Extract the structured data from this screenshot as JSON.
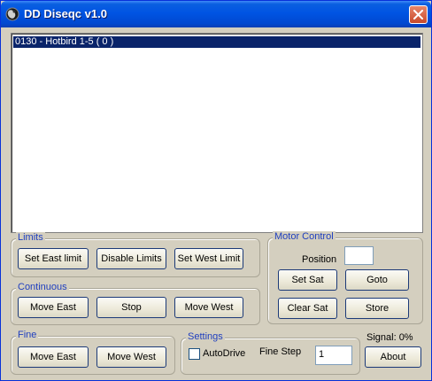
{
  "window": {
    "title": "DD Diseqc v1.0",
    "icons": {
      "app": "satellite-dish-icon",
      "close": "close-icon"
    },
    "colors": {
      "titlebar": "#0054e3",
      "face": "#d4cfbf",
      "selection": "#0a246a",
      "group_title": "#1f3fbf"
    }
  },
  "channel_list": {
    "items": [
      {
        "label": "0130 - Hotbird 1-5 ( 0 )",
        "selected": true
      }
    ]
  },
  "limits": {
    "title": "Limits",
    "set_east_label": "Set East limit",
    "disable_label": "Disable Limits",
    "set_west_label": "Set West Limit"
  },
  "continuous": {
    "title": "Continuous",
    "move_east_label": "Move East",
    "stop_label": "Stop",
    "move_west_label": "Move West"
  },
  "fine": {
    "title": "Fine",
    "move_east_label": "Move East",
    "move_west_label": "Move West"
  },
  "settings": {
    "title": "Settings",
    "autodrive_label": "AutoDrive",
    "autodrive_checked": false,
    "fine_step_label": "Fine Step",
    "fine_step_value": "1"
  },
  "motor_control": {
    "title": "Motor Control",
    "position_label": "Position",
    "position_value": "",
    "set_sat_label": "Set Sat",
    "goto_label": "Goto",
    "clear_sat_label": "Clear Sat",
    "store_label": "Store"
  },
  "status": {
    "signal_text": "Signal: 0%",
    "about_label": "About"
  }
}
